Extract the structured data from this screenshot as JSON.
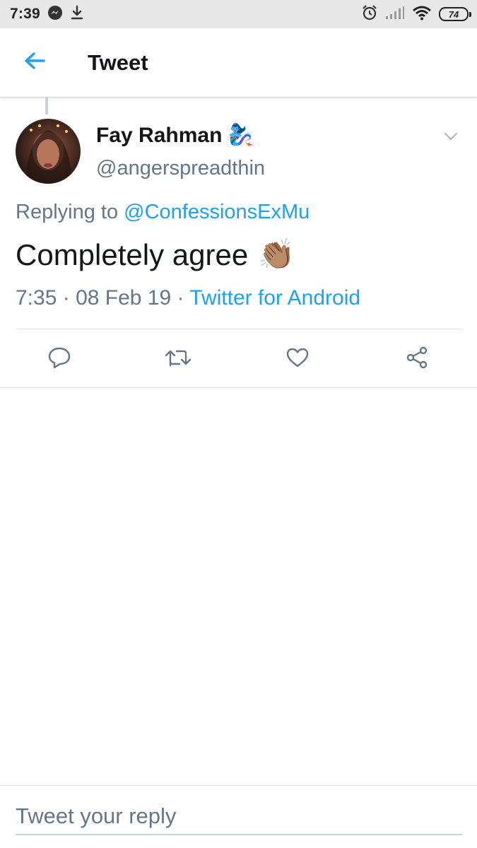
{
  "status_bar": {
    "time": "7:39",
    "battery": "74",
    "icons": [
      "messenger-icon",
      "download-icon",
      "alarm-icon",
      "signal-icon",
      "wifi-icon",
      "battery-icon"
    ]
  },
  "header": {
    "title": "Tweet",
    "back_icon": "arrow-left-icon"
  },
  "tweet": {
    "author_name": "Fay Rahman",
    "author_emoji": "🧞‍♀️",
    "handle": "@angerspreadthin",
    "replying_prefix": "Replying to ",
    "replying_to": "@ConfessionsExMu",
    "text": "Completely agree",
    "text_emoji": "👏🏽",
    "time": "7:35",
    "separator": " · ",
    "date": "08 Feb 19",
    "source": "Twitter for Android"
  },
  "actions": [
    "reply-icon",
    "retweet-icon",
    "like-icon",
    "share-icon"
  ],
  "reply_box": {
    "placeholder": "Tweet your reply"
  },
  "colors": {
    "accent": "#1da1f2",
    "secondary_text": "#657786",
    "primary_text": "#14171a",
    "status_bar_bg": "#e8e8e8"
  }
}
